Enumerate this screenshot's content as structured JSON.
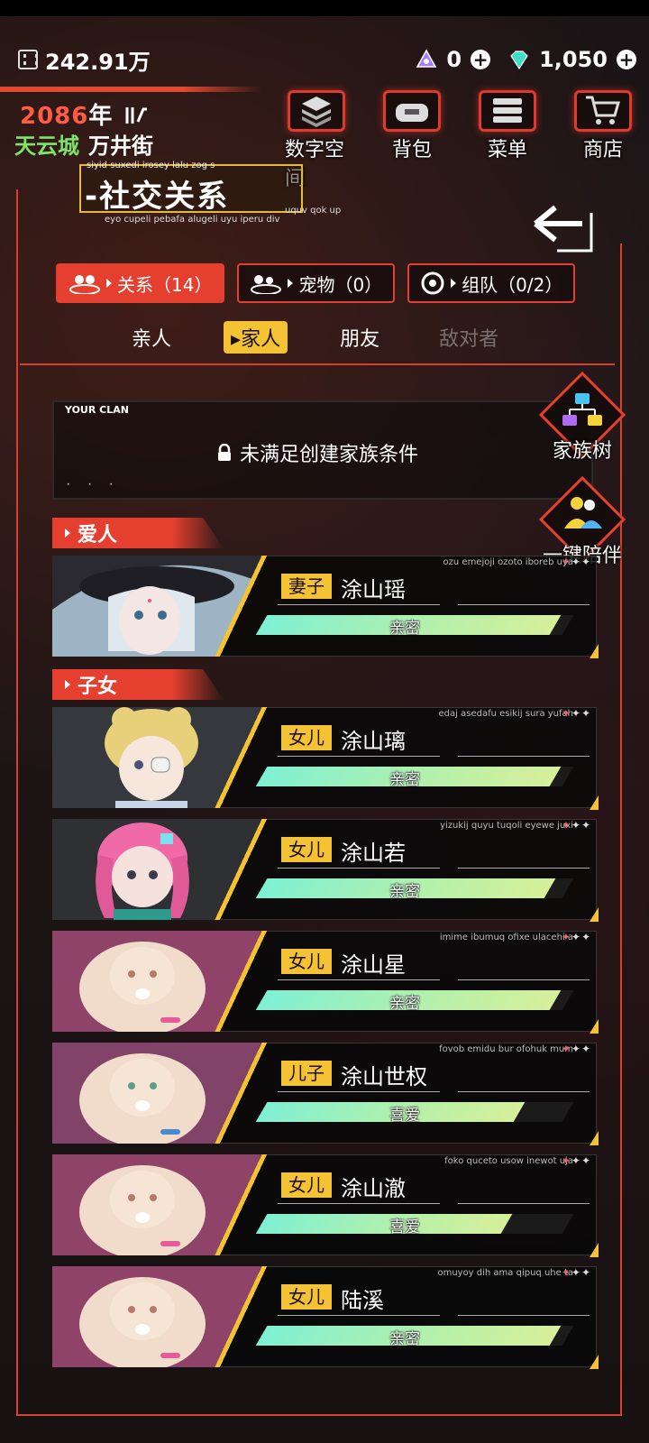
{
  "topbar": {
    "money": "242.91万",
    "currency_a": "0",
    "currency_b": "1,050"
  },
  "header": {
    "year": "2086",
    "year_char": "年",
    "city": "天云城",
    "street": "万井街"
  },
  "nav": {
    "digital_space": "数字空间",
    "bag": "背包",
    "menu": "菜单",
    "shop": "商店"
  },
  "title": {
    "main": "-社交关系",
    "sub1": "siyid suxedi irosey lalu zog s",
    "sub2": "eyo cupeli pebafa alugeli uyu iperu div",
    "sub3": "uquv qok up"
  },
  "categories": [
    {
      "label": "关系（14）"
    },
    {
      "label": "宠物（0）"
    },
    {
      "label": "组队（0/2）"
    }
  ],
  "subtabs": [
    "亲人",
    "家人",
    "朋友",
    "敌对者"
  ],
  "clan": {
    "label": "YOUR CLAN",
    "message": "未满足创建家族条件",
    "dots": "· · ·"
  },
  "side_buttons": {
    "family_tree": "家族树",
    "accompany": "一键陪伴"
  },
  "sections": {
    "lover": "爱人",
    "children": "子女"
  },
  "members": [
    {
      "role": "妻子",
      "name": "涂山瑶",
      "meta": "ozu emejoji ozoto iboreb uya",
      "bond": "亲密",
      "bond_level": 0.96,
      "portrait": "hat-girl"
    },
    {
      "role": "女儿",
      "name": "涂山璃",
      "meta": "edaj asedafu esikij sura yufah",
      "bond": "亲密",
      "bond_level": 0.96,
      "portrait": "blonde-girl"
    },
    {
      "role": "女儿",
      "name": "涂山若",
      "meta": "yizukij quyu tuqoli eyewe juxi",
      "bond": "亲密",
      "bond_level": 0.94,
      "portrait": "pink-girl"
    },
    {
      "role": "女儿",
      "name": "涂山星",
      "meta": "imime ibumuq ofixe ulacehi a",
      "bond": "亲密",
      "bond_level": 0.96,
      "portrait": "baby-pink"
    },
    {
      "role": "儿子",
      "name": "涂山世权",
      "meta": "fovob emidu bur ofohuk mum",
      "bond": "喜爱",
      "bond_level": 0.84,
      "portrait": "baby-blue"
    },
    {
      "role": "女儿",
      "name": "涂山澈",
      "meta": "foko quceto usow inewot uja",
      "bond": "喜爱",
      "bond_level": 0.8,
      "portrait": "baby-pink"
    },
    {
      "role": "女儿",
      "name": "陆溪",
      "meta": "omuyoy dih ama qipuq uhe ta",
      "bond": "亲密",
      "bond_level": 0.96,
      "portrait": "baby-pink"
    }
  ],
  "colors": {
    "accent_red": "#e5402f",
    "accent_yellow": "#f4c232",
    "city_green": "#7fe36a",
    "bar_start": "#7ff0d4",
    "bar_end": "#d6ef9a"
  }
}
